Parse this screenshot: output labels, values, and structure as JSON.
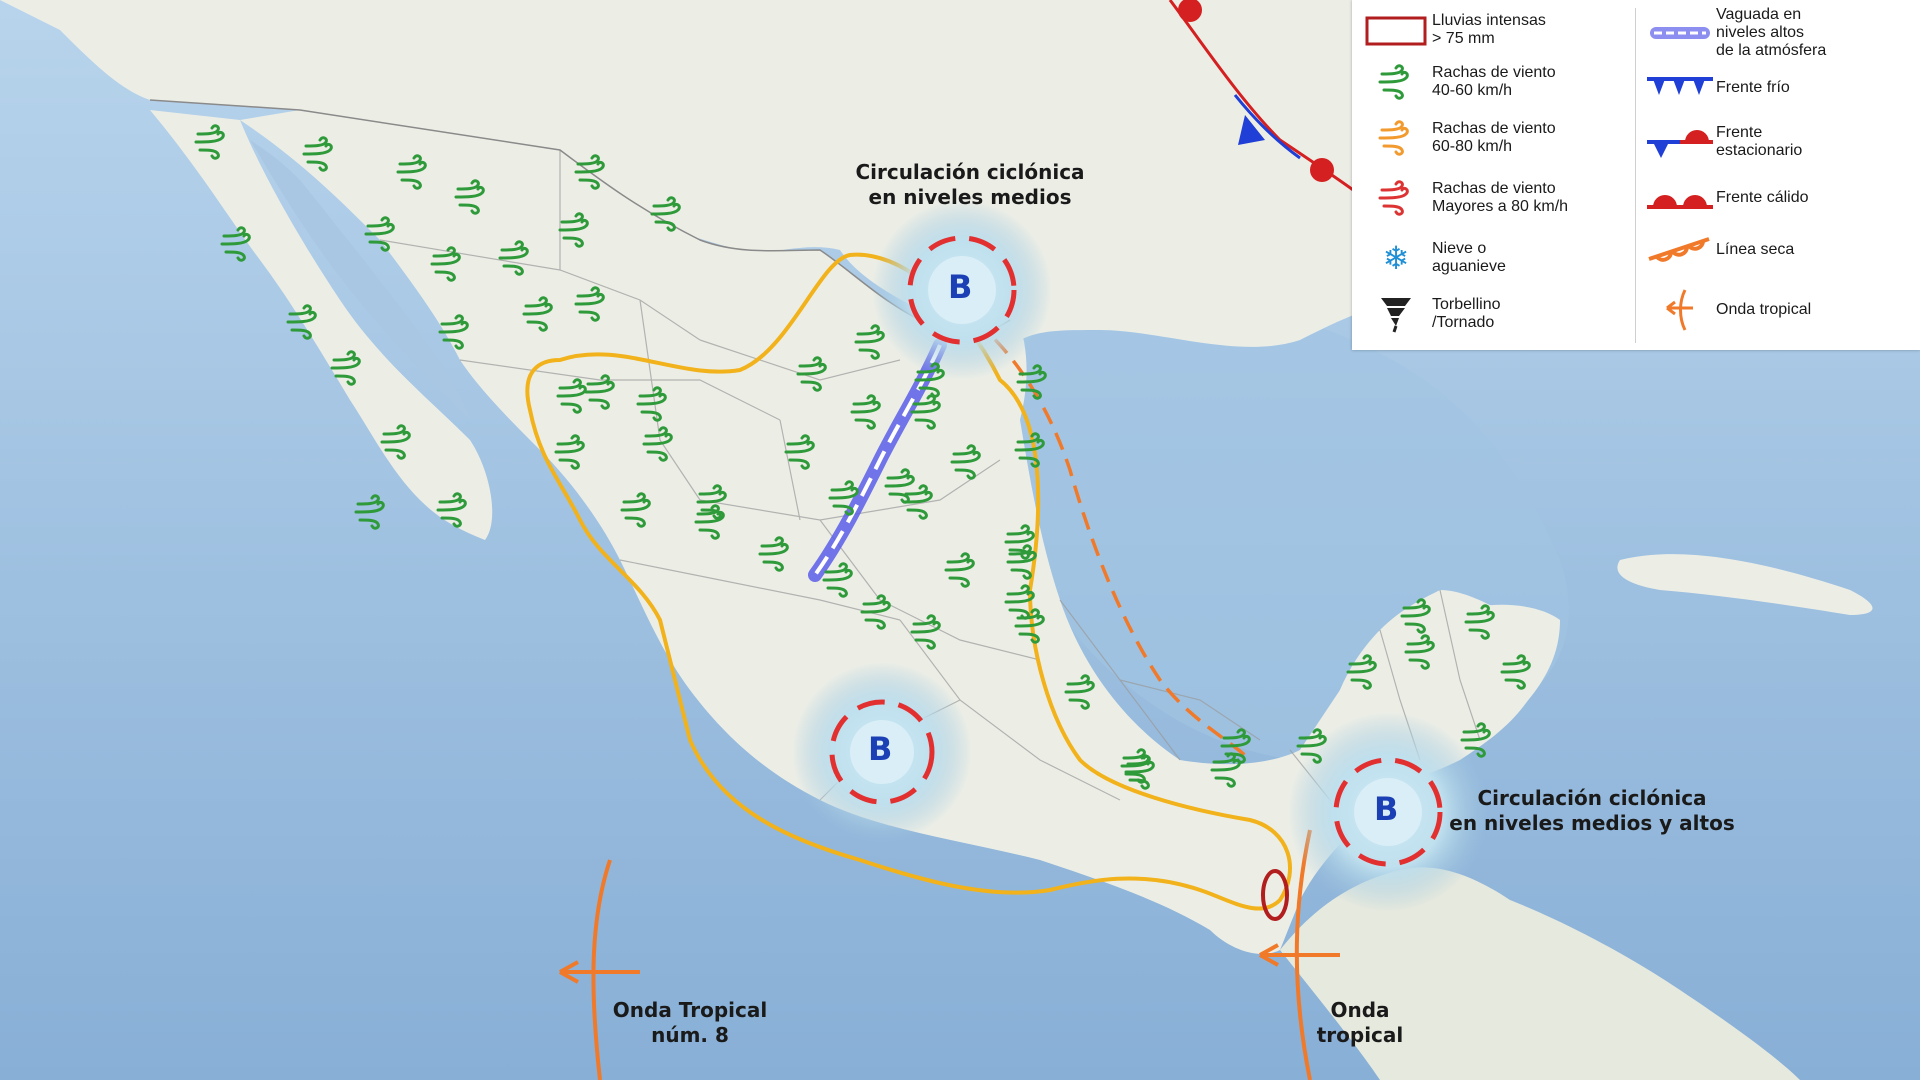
{
  "legend": {
    "left": [
      {
        "label": "Lluvias intensas\n> 75 mm",
        "icon": "rain-area-icon"
      },
      {
        "label": "Rachas de viento\n40-60 km/h",
        "icon": "wind-green-icon",
        "color": "#2e9a3a"
      },
      {
        "label": "Rachas de viento\n60-80 km/h",
        "icon": "wind-orange-icon",
        "color": "#f29a2e"
      },
      {
        "label": "Rachas de viento\nMayores a 80 km/h",
        "icon": "wind-red-icon",
        "color": "#d33"
      },
      {
        "label": "Nieve o\naguanieve",
        "icon": "snowflake-icon"
      },
      {
        "label": "Torbellino\n/Tornado",
        "icon": "tornado-icon"
      }
    ],
    "right": [
      {
        "label": "Vaguada en\nniveles altos\nde la atmósfera",
        "icon": "upper-trough-icon"
      },
      {
        "label": "Frente frío",
        "icon": "cold-front-icon"
      },
      {
        "label": "Frente\nestacionario",
        "icon": "stationary-front-icon"
      },
      {
        "label": "Frente cálido",
        "icon": "warm-front-icon"
      },
      {
        "label": "Línea seca",
        "icon": "dry-line-icon"
      },
      {
        "label": "Onda tropical",
        "icon": "tropical-wave-icon"
      }
    ]
  },
  "labels": {
    "circ_mid": "Circulación ciclónica\nen niveles medios",
    "circ_mid_high": "Circulación ciclónica\nen niveles medios y altos",
    "tropical_wave_8": "Onda Tropical\nnúm. 8",
    "tropical_wave": "Onda\ntropical"
  },
  "lows": [
    "B",
    "B",
    "B"
  ],
  "colors": {
    "ocean": "#a9c7e3",
    "land": "#eceee6",
    "wind_green": "#2e9a3a",
    "outline_yellow": "#f2b21b",
    "dry_line": "#f07a2a",
    "low_letter": "#1b3fb4",
    "front_red": "#d42020",
    "front_blue": "#1f3fd6"
  }
}
